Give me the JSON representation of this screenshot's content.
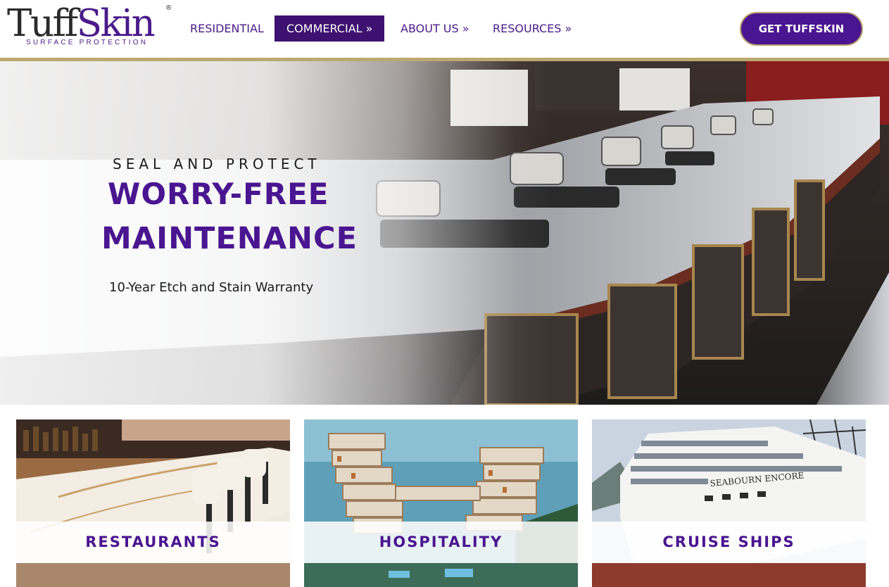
{
  "header": {
    "logo": {
      "brand_tuff": "Tuff",
      "brand_skin": "Skin",
      "registered": "®",
      "tagline": "SURFACE PROTECTION"
    },
    "nav": [
      {
        "label": "RESIDENTIAL",
        "active": false
      },
      {
        "label": "COMMERCIAL »",
        "active": true
      },
      {
        "label": "ABOUT US »",
        "active": false
      },
      {
        "label": "RESOURCES »",
        "active": false
      }
    ],
    "cta_label": "GET TUFFSKIN"
  },
  "hero": {
    "eyebrow": "SEAL AND PROTECT",
    "title_line1": "WORRY-FREE",
    "title_line2": "MAINTENANCE",
    "subtitle": "10-Year Etch and Stain Warranty"
  },
  "cards": [
    {
      "label": "RESTAURANTS"
    },
    {
      "label": "HOSPITALITY"
    },
    {
      "label": "CRUISE SHIPS"
    }
  ],
  "colors": {
    "brand_purple": "#4a1590",
    "nav_active_bg": "#3d116f",
    "gold_accent": "#bba96f",
    "text_dark": "#1b1b1b"
  },
  "icons": [
    "registered-mark"
  ]
}
